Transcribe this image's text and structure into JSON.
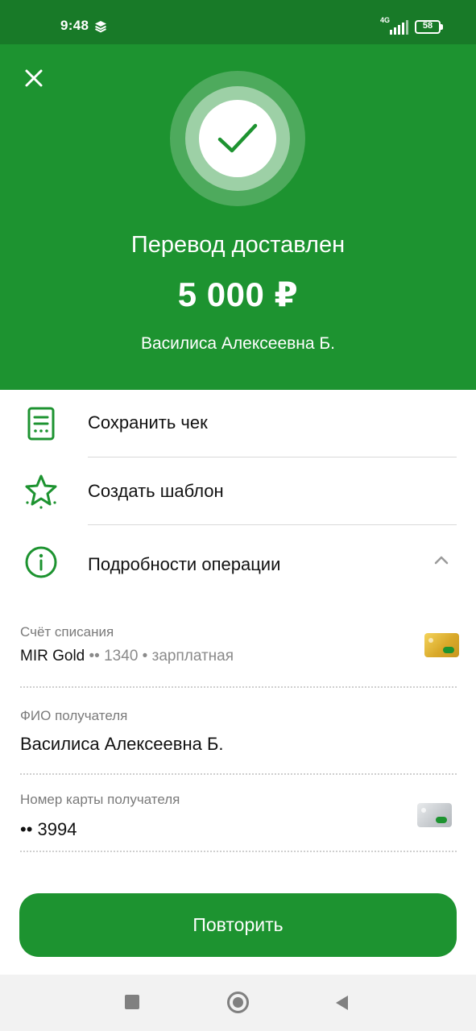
{
  "status_bar": {
    "time": "9:48",
    "network": "4G",
    "battery": "58"
  },
  "hero": {
    "title": "Перевод доставлен",
    "amount": "5 000 ₽",
    "recipient": "Василиса Алексеевна Б."
  },
  "actions": [
    {
      "label": "Сохранить чек",
      "icon": "receipt-icon"
    },
    {
      "label": "Создать шаблон",
      "icon": "star-icon"
    },
    {
      "label": "Подробности операции",
      "icon": "info-icon"
    }
  ],
  "details": {
    "account": {
      "label": "Счёт списания",
      "card_name": "MIR Gold",
      "card_mask": "•• 1340",
      "card_type": "• зарплатная"
    },
    "recipient_name": {
      "label": "ФИО получателя",
      "value": "Василиса Алексеевна Б."
    },
    "recipient_card": {
      "label": "Номер карты получателя",
      "value": "•• 3994"
    }
  },
  "buttons": {
    "repeat": "Повторить"
  },
  "colors": {
    "primary_green": "#1d9330",
    "status_green": "#187a28"
  }
}
